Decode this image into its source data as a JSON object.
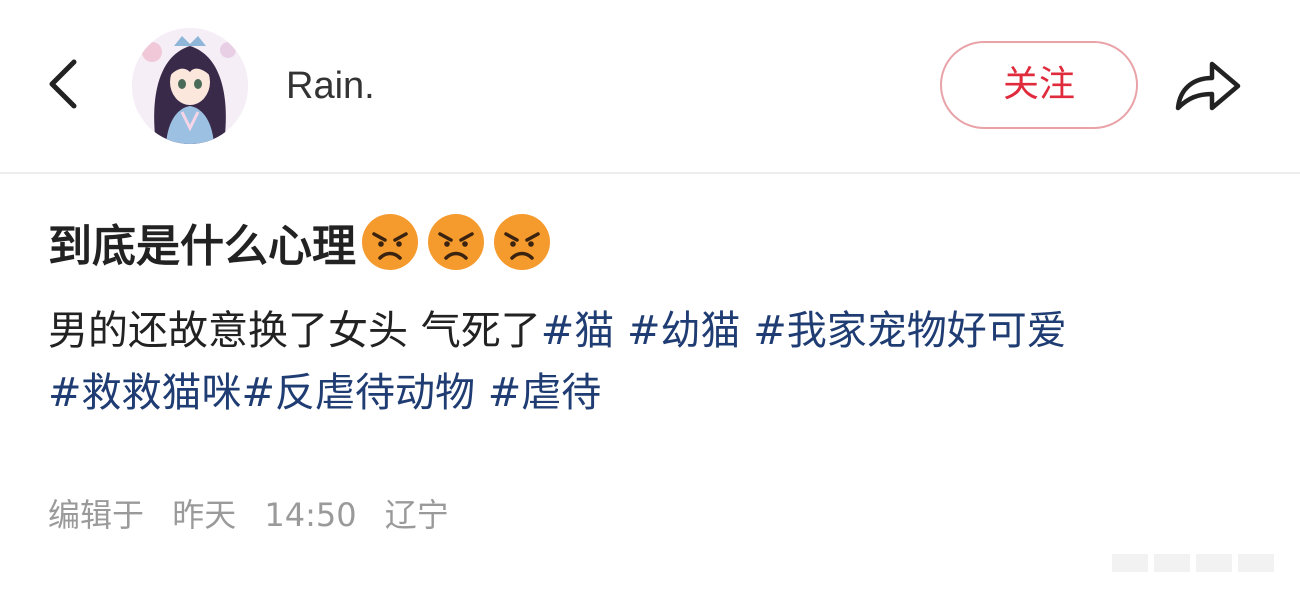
{
  "header": {
    "username": "Rain.",
    "follow_label": "关注",
    "back_icon": "chevron-left-icon",
    "share_icon": "share-arrow-icon"
  },
  "post": {
    "title": "到底是什么心理",
    "title_emojis": [
      "angry-face",
      "angry-face",
      "angry-face"
    ],
    "body_text": "男的还故意换了女头 气死了",
    "hashtags": [
      "#猫",
      "#幼猫",
      "#我家宠物好可爱",
      "#救救猫咪",
      "#反虐待动物",
      "#虐待"
    ]
  },
  "meta": {
    "action": "编辑于",
    "day": "昨天",
    "time": "14:50",
    "location": "辽宁"
  },
  "colors": {
    "accent": "#e02b3d",
    "hashtag": "#1f3c73",
    "meta": "#9a9a9a",
    "emoji": "#f59a2c"
  }
}
